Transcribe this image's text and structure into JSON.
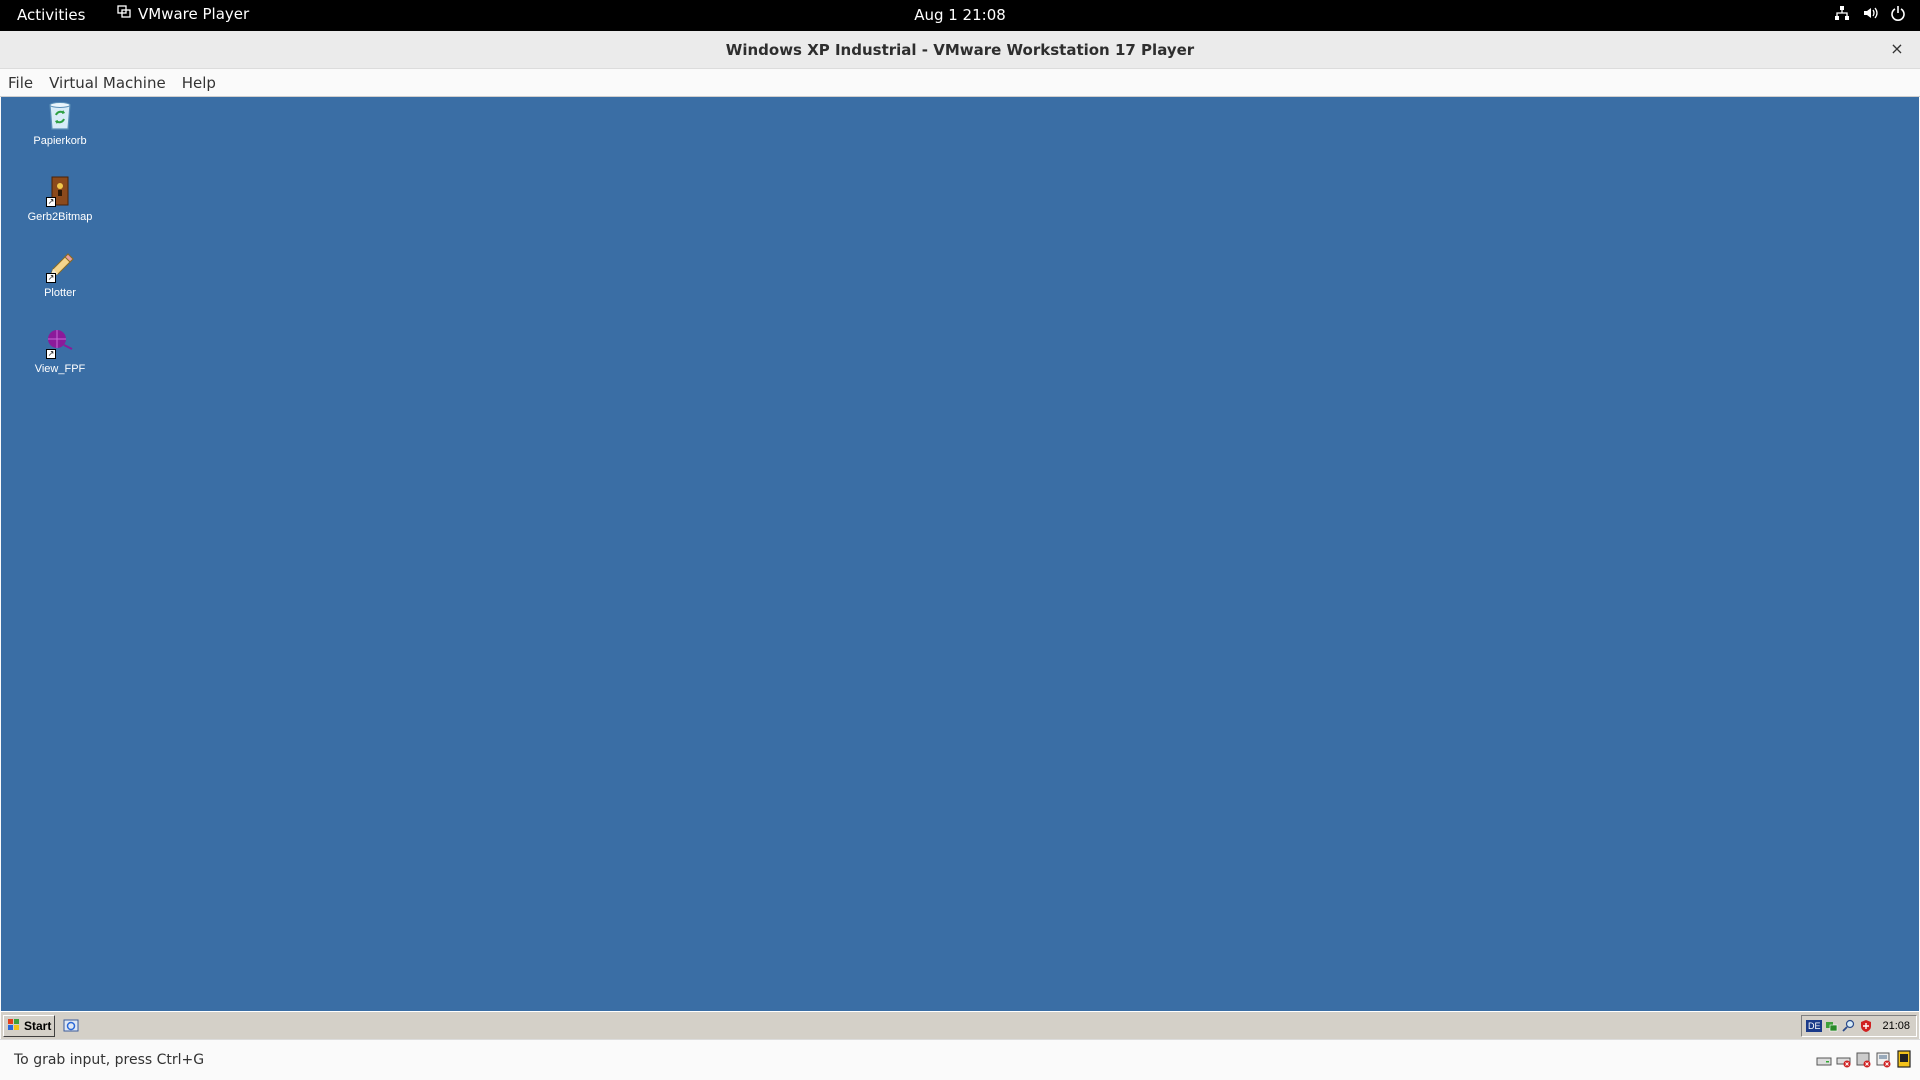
{
  "topbar": {
    "activities": "Activities",
    "app_name": "VMware Player",
    "datetime": "Aug 1  21:08"
  },
  "window": {
    "title": "Windows XP Industrial - VMware Workstation 17 Player",
    "close": "×"
  },
  "menubar": {
    "items": [
      "File",
      "Virtual Machine",
      "Help"
    ]
  },
  "desktop": {
    "background": "#3a6ea5",
    "icons": [
      {
        "label": "Papierkorb",
        "icon": "recycle-bin-icon"
      },
      {
        "label": "Gerb2Bitmap",
        "icon": "gerb2bitmap-icon"
      },
      {
        "label": "Plotter",
        "icon": "pencil-icon"
      },
      {
        "label": "View_FPF",
        "icon": "crosshair-icon"
      }
    ]
  },
  "taskbar": {
    "start_label": "Start",
    "tray_lang": "DE",
    "clock": "21:08"
  },
  "statusbar": {
    "hint": "To grab input, press Ctrl+G"
  }
}
